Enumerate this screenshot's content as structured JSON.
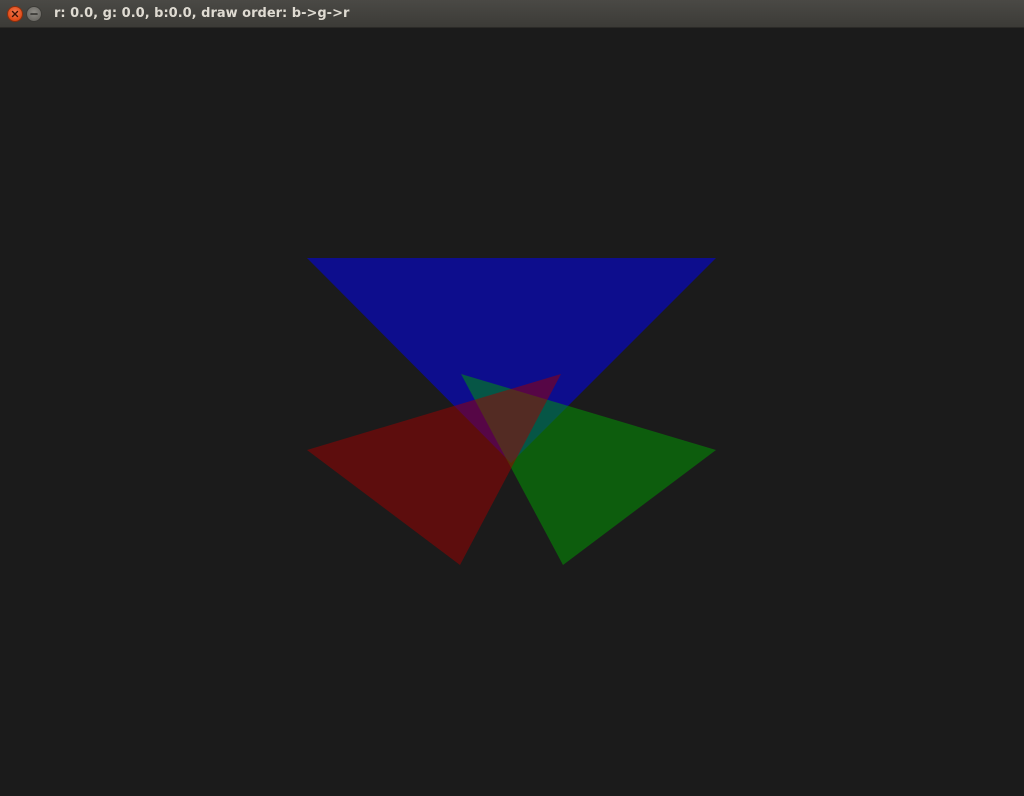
{
  "window": {
    "title": "r: 0.0, g: 0.0, b:0.0, draw order: b->g->r"
  },
  "scene": {
    "background_color": "#1b1b1b",
    "draw_order": [
      "blue",
      "green",
      "red"
    ],
    "triangles": [
      {
        "name": "blue",
        "fill": "#0000ff",
        "opacity": 0.5
      },
      {
        "name": "green",
        "fill": "#00a000",
        "opacity": 0.5
      },
      {
        "name": "red",
        "fill": "#a00000",
        "opacity": 0.5
      }
    ]
  },
  "icons": {
    "close": "close-icon",
    "minimize": "minimize-icon"
  }
}
